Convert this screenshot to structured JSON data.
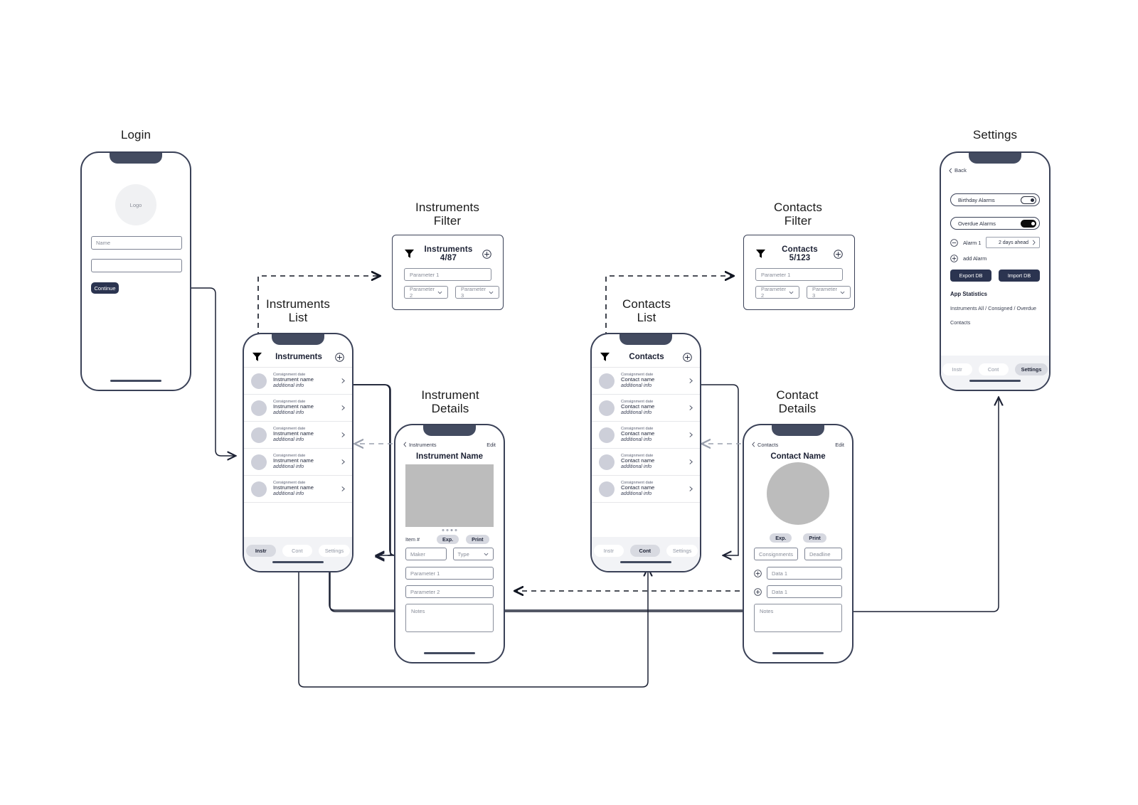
{
  "captions": {
    "login": "Login",
    "instruments_filter": "Instruments\nFilter",
    "instruments_list": "Instruments\nList",
    "instrument_details": "Instrument\nDetails",
    "contacts_filter": "Contacts\nFilter",
    "contacts_list": "Contacts\nList",
    "contact_details": "Contact\nDetails",
    "settings": "Settings"
  },
  "login": {
    "logo_label": "Logo",
    "name_placeholder": "Name",
    "password_placeholder": "",
    "continue_label": "Continue"
  },
  "instruments_filter": {
    "title": "Instruments 4/87",
    "funnel_icon": "funnel-icon",
    "add_icon": "plus-circle-icon",
    "param1": "Parameter 1",
    "param2": "Parameter 2",
    "param3": "Parameter 3"
  },
  "contacts_filter": {
    "title": "Contacts 5/123",
    "funnel_icon": "funnel-icon",
    "add_icon": "plus-circle-icon",
    "param1": "Parameter 1",
    "param2": "Parameter 2",
    "param3": "Parameter 3"
  },
  "instruments_list": {
    "title": "Instruments",
    "funnel_icon": "funnel-icon",
    "add_icon": "plus-circle-icon",
    "rows": [
      {
        "date": "Consignment date",
        "name": "Instrument name",
        "info": "additional info"
      },
      {
        "date": "Consignment date",
        "name": "Instrument name",
        "info": "additional info"
      },
      {
        "date": "Consignment date",
        "name": "Instrument name",
        "info": "additional info"
      },
      {
        "date": "Consignment date",
        "name": "Instrument name",
        "info": "additional info"
      },
      {
        "date": "Consignment date",
        "name": "Instrument name",
        "info": "additional info"
      }
    ],
    "tabs": [
      {
        "label": "Instr",
        "active": true
      },
      {
        "label": "Cont",
        "active": false
      },
      {
        "label": "Settings",
        "active": false
      }
    ]
  },
  "contacts_list": {
    "title": "Contacts",
    "funnel_icon": "funnel-icon",
    "add_icon": "plus-circle-icon",
    "rows": [
      {
        "date": "Consignment date",
        "name": "Contact name",
        "info": "additional info"
      },
      {
        "date": "Consignment date",
        "name": "Contact name",
        "info": "additional info"
      },
      {
        "date": "Consignment date",
        "name": "Contact name",
        "info": "additional info"
      },
      {
        "date": "Consignment date",
        "name": "Contact name",
        "info": "additional info"
      },
      {
        "date": "Consignment date",
        "name": "Contact name",
        "info": "additional info"
      }
    ],
    "tabs": [
      {
        "label": "Instr",
        "active": false
      },
      {
        "label": "Cont",
        "active": true
      },
      {
        "label": "Settings",
        "active": false
      }
    ]
  },
  "instrument_details": {
    "back_label": "Instruments",
    "edit_label": "Edit",
    "title": "Instrument Name",
    "carousel_dots": 4,
    "carousel_active_index": 2,
    "item_label": "Item #",
    "exp_label": "Exp.",
    "print_label": "Print",
    "maker_placeholder": "Maker",
    "type_placeholder": "Type",
    "param1": "Parameter 1",
    "param2": "Parameter 2",
    "notes_placeholder": "Notes"
  },
  "contact_details": {
    "back_label": "Contacts",
    "edit_label": "Edit",
    "title": "Contact Name",
    "exp_label": "Exp.",
    "print_label": "Print",
    "consignments_placeholder": "Consignments",
    "deadline_placeholder": "Deadline",
    "data1_placeholder": "Data 1",
    "data2_placeholder": "Data 1",
    "notes_placeholder": "Notes"
  },
  "settings": {
    "back_label": "Back",
    "birthday_alarms_label": "Birthday Alarms",
    "birthday_alarms_state": "off",
    "overdue_alarms_label": "Overdue Alarms",
    "overdue_alarms_state": "on",
    "alarm_label": "Alarm 1",
    "alarm_value": "2 days ahead",
    "add_alarm_label": "add Alarm",
    "export_db_label": "Export DB",
    "import_db_label": "Import DB",
    "app_statistics_label": "App Statistics",
    "stat_instruments": "Instruments   All / Consigned / Overdue",
    "stat_contacts": "Contacts",
    "tabs": [
      {
        "label": "Instr",
        "active": false
      },
      {
        "label": "Cont",
        "active": false
      },
      {
        "label": "Settings",
        "active": true
      }
    ]
  },
  "colors": {
    "frame": "#3a4157",
    "notch": "#434b60",
    "primary": "#2b3450",
    "avatar": "#cdcfd9",
    "image_placeholder": "#bcbcbc",
    "tabbar": "#f2f3f6",
    "tab_active": "#d8dae1",
    "connector": "#1b2033",
    "connector_dim": "#9aa0ad"
  }
}
